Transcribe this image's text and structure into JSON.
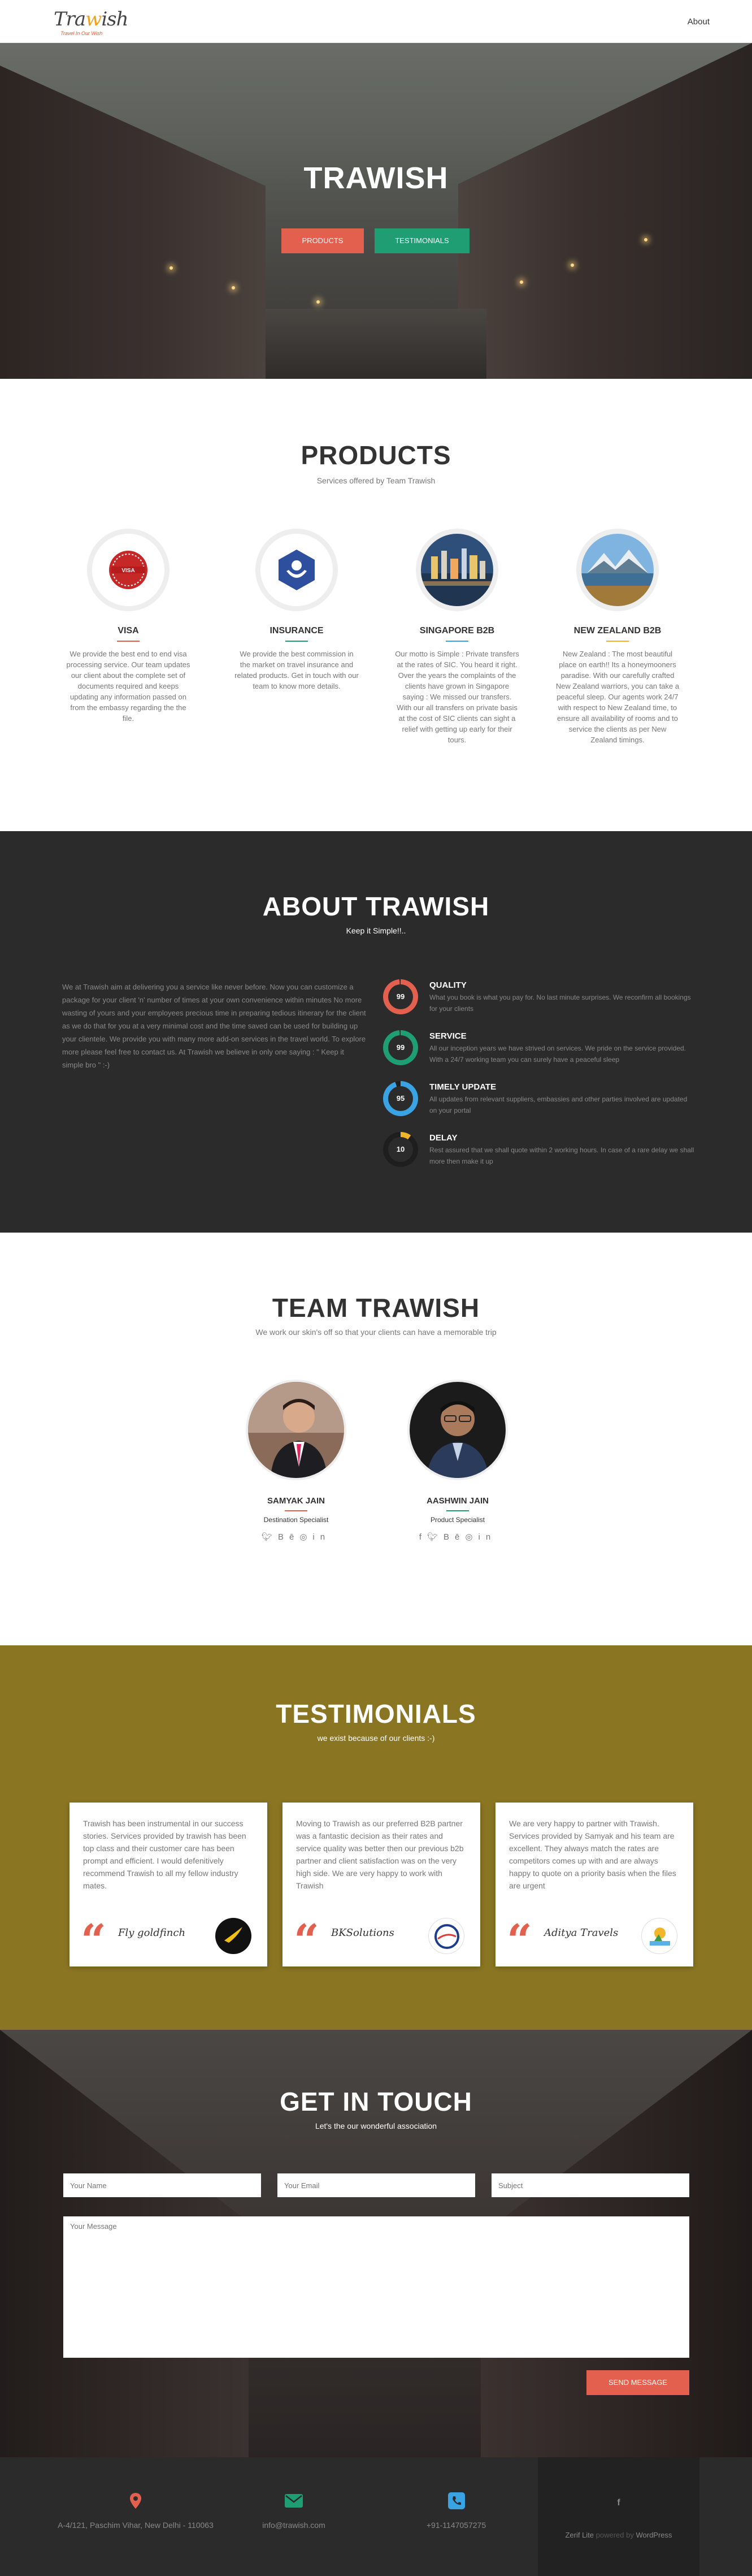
{
  "header": {
    "logo_text": "Trawish",
    "logo_tagline": "Travel In Our Wish",
    "nav_about": "About"
  },
  "hero": {
    "title": "TRAWISH",
    "btn_products": "PRODUCTS",
    "btn_testimonials": "TESTIMONIALS"
  },
  "products": {
    "title": "PRODUCTS",
    "subtitle": "Services offered by Team Trawish",
    "items": [
      {
        "name": "VISA",
        "accent": "#e4604e",
        "desc": "We provide the best end to end visa processing service. Our team updates our client about the complete set of documents required and keeps updating any information passed on from the embassy regarding the the file."
      },
      {
        "name": "INSURANCE",
        "accent": "#1f9e73",
        "desc": "We provide the best commission in the market on travel insurance and related products. Get in touch with our team to know more details."
      },
      {
        "name": "SINGAPORE B2B",
        "accent": "#3aa3e3",
        "desc": "Our motto is Simple : Private transfers at the rates of SIC. You heard it right. Over the years the complaints of the clients have grown in Singapore saying : We missed our transfers. With our all transfers on private basis at the cost of SIC clients can sight a relief with getting up early for their tours."
      },
      {
        "name": "NEW ZEALAND B2B",
        "accent": "#f0b429",
        "desc": "New Zealand : The most beautiful place on earth!! Its a honeymooners paradise. With our carefully crafted New Zealand warriors, you can take a peaceful sleep. Our agents work 24/7 with respect to New Zealand time, to ensure all availability of rooms and to service the clients as per New Zealand timings."
      }
    ]
  },
  "about": {
    "title": "ABOUT TRAWISH",
    "subtitle": "Keep it Simple!!..",
    "text": "We at Trawish aim at delivering you a service like never before. Now you can customize a package for your client 'n' number of times at your own convenience within minutes No more wasting of yours and your employees precious time in preparing tedious itinerary for the client as we do that for you at a very minimal cost and the time saved can be used for building up your clientele. We provide you with many more add-on services in the travel world. To explore more please feel free to contact us. At Trawish we believe in only one saying : \" Keep it simple bro \" :-)",
    "skills": [
      {
        "value": "99",
        "percent": 99,
        "color": "#e4604e",
        "title": "QUALITY",
        "desc": "What you book is what you pay for. No last minute surprises. We reconfirm all bookings for your clients"
      },
      {
        "value": "99",
        "percent": 99,
        "color": "#1f9e73",
        "title": "SERVICE",
        "desc": "All our inception years we have strived on services. We pride on the service provided. With a 24/7 working team you can surely have a peaceful sleep"
      },
      {
        "value": "95",
        "percent": 95,
        "color": "#3aa3e3",
        "title": "TIMELY UPDATE",
        "desc": "All updates from relevant suppliers, embassies and other parties involved are updated on your portal"
      },
      {
        "value": "10",
        "percent": 10,
        "color": "#f0b429",
        "title": "DELAY",
        "desc": "Rest assured that we shall quote within 2 working hours. In case of a rare delay we shall more then make it up"
      }
    ]
  },
  "team": {
    "title": "TEAM TRAWISH",
    "subtitle": "We work our skin's off so that your clients can have a memorable trip",
    "members": [
      {
        "name": "SAMYAK JAIN",
        "role": "Destination Specialist",
        "accent": "#e4604e",
        "socials": [
          "twitter-icon",
          "behance-icon",
          "dribbble-icon",
          "linkedin-icon"
        ]
      },
      {
        "name": "AASHWIN JAIN",
        "role": "Product Specialist",
        "accent": "#1f9e73",
        "socials": [
          "facebook-icon",
          "twitter-icon",
          "behance-icon",
          "dribbble-icon",
          "linkedin-icon"
        ]
      }
    ]
  },
  "testimonials": {
    "title": "TESTIMONIALS",
    "subtitle": "we exist because of our clients :-)",
    "items": [
      {
        "text": "Trawish has been instrumental in our success stories. Services provided by trawish has been top class and their customer care has been prompt and efficient. I would defenitively recommend Trawish to all my fellow industry mates.",
        "signature": "Fly goldfinch"
      },
      {
        "text": "Moving to Trawish as our preferred B2B partner was a fantastic decision as their rates and service quality was better then our previous b2b partner and client satisfaction was on the very high side. We are very happy to work with Trawish",
        "signature": "BKSolutions"
      },
      {
        "text": "We are very happy to partner with Trawish. Services provided by Samyak and his team are excellent. They always match the rates are competitors comes up with and are always happy to quote on a priority basis when the files are urgent",
        "signature": "Aditya Travels"
      }
    ]
  },
  "contact": {
    "title": "GET IN TOUCH",
    "subtitle": "Let's the our wonderful association",
    "name_placeholder": "Your Name",
    "email_placeholder": "Your Email",
    "subject_placeholder": "Subject",
    "message_placeholder": "Your Message",
    "send_label": "SEND MESSAGE"
  },
  "footer": {
    "address": "A-4/121, Paschim Vihar, New Delhi - 110063",
    "email": "info@trawish.com",
    "phone": "+91-1147057275",
    "credit_site": "Zerif Lite",
    "credit_mid": " powered by ",
    "credit_wp": "WordPress",
    "colors": {
      "location": "#e4604e",
      "email": "#1f9e73",
      "phone": "#3aa3e3"
    }
  }
}
